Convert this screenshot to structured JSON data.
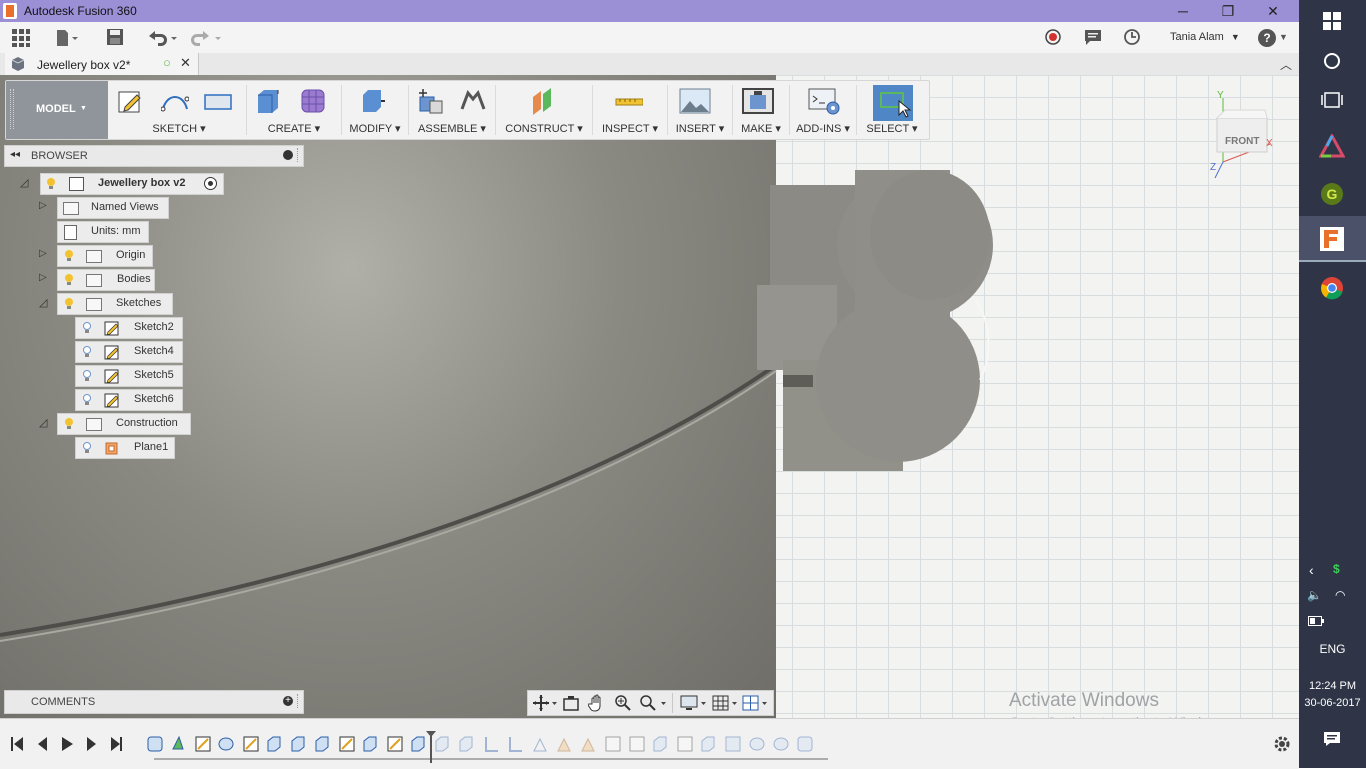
{
  "window": {
    "title": "Autodesk Fusion 360",
    "minimize": "─",
    "restore": "❐",
    "close": "✕"
  },
  "app_toolbar": {
    "user_name": "Tania Alam",
    "help": "?"
  },
  "document_tab": {
    "title": "Jewellery box v2*"
  },
  "ribbon": {
    "workspace": "MODEL",
    "groups": [
      {
        "label": "SKETCH"
      },
      {
        "label": "CREATE"
      },
      {
        "label": "MODIFY"
      },
      {
        "label": "ASSEMBLE"
      },
      {
        "label": "CONSTRUCT"
      },
      {
        "label": "INSPECT"
      },
      {
        "label": "INSERT"
      },
      {
        "label": "MAKE"
      },
      {
        "label": "ADD-INS"
      },
      {
        "label": "SELECT"
      }
    ]
  },
  "view_cube": {
    "face": "FRONT",
    "axis_x": "X",
    "axis_y": "Y",
    "axis_z": "Z"
  },
  "browser": {
    "title": "BROWSER",
    "root": "Jewellery box v2",
    "nodes": [
      {
        "label": "Named Views"
      },
      {
        "label": "Units: mm"
      },
      {
        "label": "Origin"
      },
      {
        "label": "Bodies"
      },
      {
        "label": "Sketches"
      },
      {
        "label": "Sketch2"
      },
      {
        "label": "Sketch4"
      },
      {
        "label": "Sketch5"
      },
      {
        "label": "Sketch6"
      },
      {
        "label": "Construction"
      },
      {
        "label": "Plane1"
      }
    ]
  },
  "comments": {
    "title": "COMMENTS"
  },
  "watermark": {
    "line1": "Activate Windows",
    "line2": "Go to Settings to activate Windows."
  },
  "taskbar": {
    "language": "ENG",
    "time": "12:24 PM",
    "date": "30-06-2017"
  },
  "colors": {
    "title_bar": "#9b8fd6",
    "taskbar": "#2f3547",
    "accent": "#4f86c6",
    "bulb": "#f2c230"
  }
}
